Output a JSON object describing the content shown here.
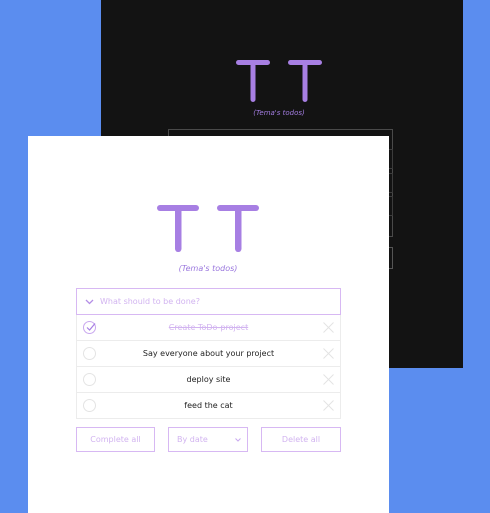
{
  "app": {
    "logo_text": "TT",
    "subtitle": "(Tema's todos)"
  },
  "input": {
    "value": "",
    "placeholder": "What should to be done?"
  },
  "todos": [
    {
      "text": "Create ToDo-project",
      "completed": true
    },
    {
      "text": "Say everyone about your project",
      "completed": false
    },
    {
      "text": "deploy site",
      "completed": false
    },
    {
      "text": "feed the cat",
      "completed": false
    }
  ],
  "controls": {
    "complete_all_label": "Complete all",
    "sort_label": "By date",
    "delete_all_label": "Delete all"
  },
  "colors": {
    "accent": "#a77fe3",
    "accent_light": "#d7b8f3",
    "page_bg": "#5b8def",
    "dark_card_bg": "#131313",
    "light_card_bg": "#ffffff"
  },
  "icons": {
    "input_toggle": "chevron-down-icon",
    "completed_check": "check-icon",
    "delete": "close-icon",
    "sort_dropdown": "chevron-down-icon"
  }
}
